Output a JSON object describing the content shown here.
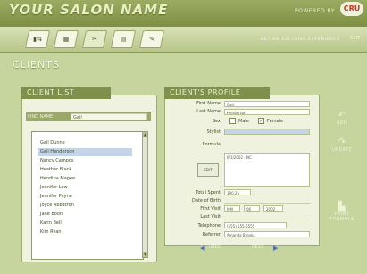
{
  "header": {
    "title": "YOUR SALON NAME",
    "powered_text": "POWERED BY",
    "logo_text": "CRU",
    "nav_text": "GET AN EXCITING EXPERIENCE",
    "exit_label": "EXIT"
  },
  "toolbar": {
    "buttons": [
      {
        "icon": "home-icon",
        "glyph": "▮⇆"
      },
      {
        "icon": "grid-icon",
        "glyph": "▦"
      },
      {
        "icon": "scissors-icon",
        "glyph": "✂"
      },
      {
        "icon": "document-icon",
        "glyph": "▤"
      },
      {
        "icon": "pen-icon",
        "glyph": "✎"
      }
    ]
  },
  "page": {
    "title": "CLIENTS"
  },
  "client_list": {
    "title": "CLIENT LIST",
    "search_label": "FIND NAME",
    "search_value": "Gail",
    "items": [
      {
        "name": "Gail Dunne",
        "selected": false
      },
      {
        "name": "Gail Henderson",
        "selected": true
      },
      {
        "name": "Nancy Campos",
        "selected": false
      },
      {
        "name": "Heather Black",
        "selected": false
      },
      {
        "name": "Hendina Magee",
        "selected": false
      },
      {
        "name": "Jennifer Low",
        "selected": false
      },
      {
        "name": "Jennifer Payne",
        "selected": false
      },
      {
        "name": "Joyce Abbatron",
        "selected": false
      },
      {
        "name": "Jane Boon",
        "selected": false
      },
      {
        "name": "Karin Bell",
        "selected": false
      },
      {
        "name": "Kim Ryan",
        "selected": false
      }
    ]
  },
  "profile": {
    "title": "CLIENT'S PROFILE",
    "first_name_label": "First Name",
    "first_name_value": "Gail",
    "last_name_label": "Last Name",
    "last_name_value": "Henderson",
    "sex_label": "Sex",
    "male_label": "Male",
    "female_label": "Female",
    "female_checked": "✓",
    "stylist_label": "Stylist",
    "formula_label": "Formula",
    "formula_value": "6/1/2002 - NC",
    "formula_icon_label": "EDIT",
    "total_spent_label": "Total Spent",
    "total_spent_value": "190.25",
    "dob_label": "Date of Birth",
    "first_visit_label": "First Visit",
    "first_visit_month": "MM",
    "first_visit_day": "06",
    "first_visit_year": "2002",
    "last_visit_label": "Last Visit",
    "telephone_label": "Telephone",
    "telephone_value": "(555) 555-5555",
    "referrer_label": "Referrer",
    "referrer_value": "Amanda Brooks"
  },
  "actions": {
    "add_label": "ADD",
    "update_label": "UPDATE",
    "print_label_line1": "PRINT",
    "print_label_line2": "FORMULA",
    "prev_label": "PREV",
    "next_label": "NEXT"
  },
  "colors": {
    "background": "#c6d49e",
    "topbar": "#8fa052",
    "panel_title": "#7f8f4c",
    "selection": "#c4d4e9",
    "accent_blue": "#4a6fb0"
  }
}
